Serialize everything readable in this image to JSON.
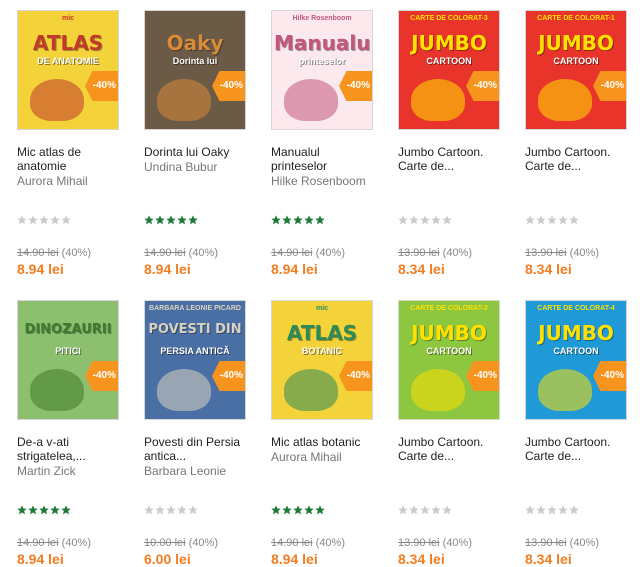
{
  "products": [
    {
      "title": "Mic atlas de anatomie",
      "author": "Aurora Mihail",
      "rating": 0,
      "old_price": "14.90 lei",
      "discount": "(40%)",
      "price": "8.94 lei",
      "badge": "-40%",
      "cover": {
        "bg": "#f3d23a",
        "accent": "#c0392b",
        "text": "ATLAS",
        "sub": "DE ANATOMIE",
        "top": "mic"
      }
    },
    {
      "title": "Dorinta lui Oaky",
      "author": "Undina Bubur",
      "rating": 5,
      "old_price": "14.90 lei",
      "discount": "(40%)",
      "price": "8.94 lei",
      "badge": "-40%",
      "cover": {
        "bg": "#6b5a45",
        "accent": "#d98b3a",
        "text": "Oaky",
        "sub": "Dorinta lui",
        "top": ""
      }
    },
    {
      "title": "Manualul printeselor",
      "author": "Hilke Rosenboom",
      "rating": 5,
      "old_price": "14.90 lei",
      "discount": "(40%)",
      "price": "8.94 lei",
      "badge": "-40%",
      "cover": {
        "bg": "#fbe9ee",
        "accent": "#c2567c",
        "text": "Manualul",
        "sub": "printeselor",
        "top": "Hilke Rosenboom"
      }
    },
    {
      "title": "Jumbo Cartoon. Carte de...",
      "author": "",
      "rating": 0,
      "old_price": "13.90 lei",
      "discount": "(40%)",
      "price": "8.34 lei",
      "badge": "-40%",
      "cover": {
        "bg": "#e8342a",
        "accent": "#ffe000",
        "text": "JUMBO",
        "sub": "CARTOON",
        "top": "CARTE DE COLORAT-3"
      }
    },
    {
      "title": "Jumbo Cartoon. Carte de...",
      "author": "",
      "rating": 0,
      "old_price": "13.90 lei",
      "discount": "(40%)",
      "price": "8.34 lei",
      "badge": "-40%",
      "cover": {
        "bg": "#e8342a",
        "accent": "#ffe000",
        "text": "JUMBO",
        "sub": "CARTOON",
        "top": "CARTE DE COLORAT-1"
      }
    },
    {
      "title": "De-a v-ati strigatelea,...",
      "author": "Martin Zick",
      "rating": 5,
      "old_price": "14.90 lei",
      "discount": "(40%)",
      "price": "8.94 lei",
      "badge": "-40%",
      "cover": {
        "bg": "#8cc06e",
        "accent": "#3f7a2e",
        "text": "DINOZAURII",
        "sub": "PITICI",
        "top": ""
      }
    },
    {
      "title": "Povesti din Persia antica...",
      "author": "Barbara Leonie",
      "rating": 0,
      "old_price": "10.00 lei",
      "discount": "(40%)",
      "price": "6.00 lei",
      "badge": "-40%",
      "cover": {
        "bg": "#4a6fa5",
        "accent": "#d9d2c0",
        "text": "POVESTI DIN",
        "sub": "PERSIA ANTICĂ",
        "top": "BARBARA LEONIE PICARD"
      }
    },
    {
      "title": "Mic atlas botanic",
      "author": "Aurora Mihail",
      "rating": 5,
      "old_price": "14.90 lei",
      "discount": "(40%)",
      "price": "8.94 lei",
      "badge": "-40%",
      "cover": {
        "bg": "#f3d23a",
        "accent": "#2e8b57",
        "text": "ATLAS",
        "sub": "BOTANIC",
        "top": "mic"
      }
    },
    {
      "title": "Jumbo Cartoon. Carte de...",
      "author": "",
      "rating": 0,
      "old_price": "13.90 lei",
      "discount": "(40%)",
      "price": "8.34 lei",
      "badge": "-40%",
      "cover": {
        "bg": "#8dc63f",
        "accent": "#ffe000",
        "text": "JUMBO",
        "sub": "CARTOON",
        "top": "CARTE DE COLORAT-2"
      }
    },
    {
      "title": "Jumbo Cartoon. Carte de...",
      "author": "",
      "rating": 0,
      "old_price": "13.90 lei",
      "discount": "(40%)",
      "price": "8.34 lei",
      "badge": "-40%",
      "cover": {
        "bg": "#1f9ad6",
        "accent": "#ffe000",
        "text": "JUMBO",
        "sub": "CARTOON",
        "top": "CARTE DE COLORAT-4"
      }
    }
  ],
  "colors": {
    "price": "#f47c20",
    "star_on": "#1f7a3a",
    "star_off": "#cccccc",
    "badge": "#f7941d"
  }
}
